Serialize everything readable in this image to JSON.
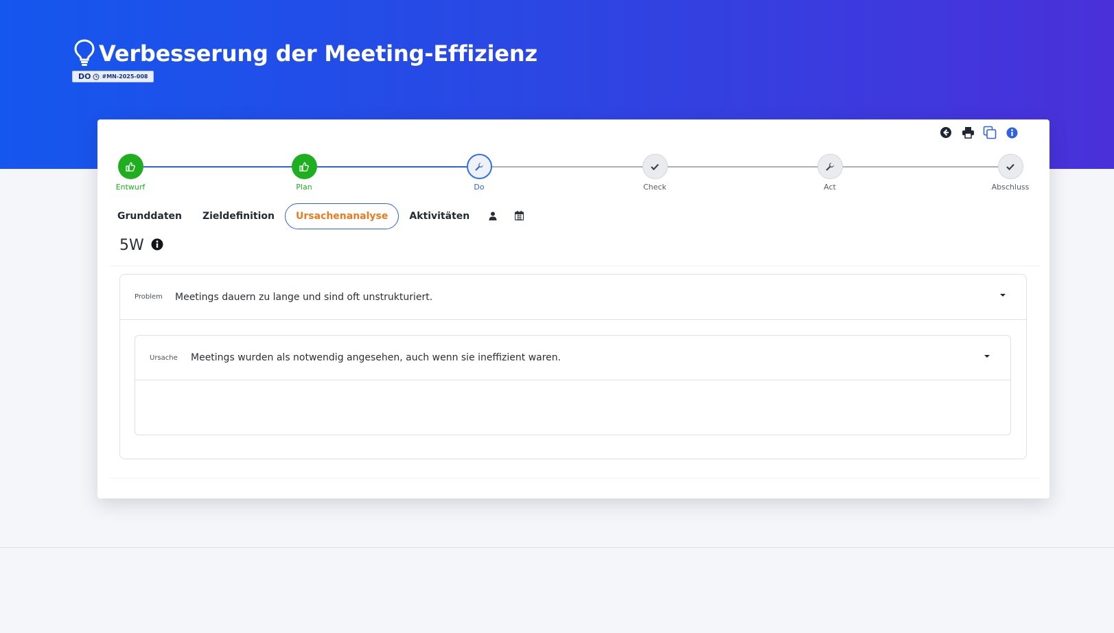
{
  "header": {
    "title": "Verbesserung der Meeting-Effizienz",
    "status": "DO",
    "identifier": "#MN-2025-008",
    "gradient_colors": [
      "#1557ee",
      "#4a30d9"
    ]
  },
  "toolbar": {
    "icons": [
      "back-icon",
      "print-icon",
      "copy-icon",
      "info-icon"
    ]
  },
  "stepper": {
    "steps": [
      {
        "label": "Entwurf",
        "state": "done",
        "icon": "thumbs-up-icon"
      },
      {
        "label": "Plan",
        "state": "done",
        "icon": "thumbs-up-icon"
      },
      {
        "label": "Do",
        "state": "current",
        "icon": "wrench-icon"
      },
      {
        "label": "Check",
        "state": "todo",
        "icon": "check-icon"
      },
      {
        "label": "Act",
        "state": "todo",
        "icon": "wrench-icon"
      },
      {
        "label": "Abschluss",
        "state": "todo",
        "icon": "check-icon"
      }
    ],
    "colors": {
      "done": "#1fae1f",
      "current": "#2f6ff0"
    }
  },
  "tabs": {
    "items": [
      {
        "label": "Grunddaten"
      },
      {
        "label": "Zieldefinition"
      },
      {
        "label": "Ursachenanalyse",
        "active": true
      },
      {
        "label": "Aktivitäten"
      }
    ],
    "icon_tabs": [
      "user-icon",
      "calendar-icon"
    ],
    "active_color": "#f07a1a"
  },
  "section": {
    "title": "5W"
  },
  "problem": {
    "label": "Problem",
    "text": "Meetings dauern zu lange und sind oft unstrukturiert."
  },
  "cause": {
    "label": "Ursache",
    "text": "Meetings wurden als notwendig angesehen, auch wenn sie ineffizient waren."
  }
}
